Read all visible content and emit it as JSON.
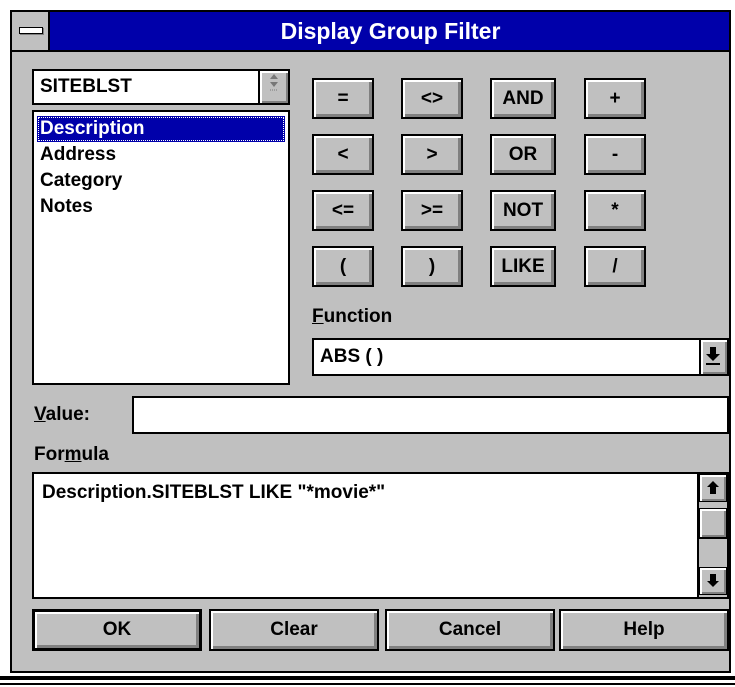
{
  "window": {
    "title": "Display Group Filter"
  },
  "table_combo": {
    "value": "SITEBLST"
  },
  "fields": {
    "items": [
      "Description",
      "Address",
      "Category",
      "Notes"
    ],
    "selected_index": 0
  },
  "operators": {
    "row1": [
      "=",
      "<>",
      "AND",
      "+"
    ],
    "row2": [
      "<",
      ">",
      "OR",
      "-"
    ],
    "row3": [
      "<=",
      ">=",
      "NOT",
      "*"
    ],
    "row4": [
      "(",
      ")",
      "LIKE",
      "/"
    ]
  },
  "function": {
    "label_mnemonic": "F",
    "label_rest": "unction",
    "value": "ABS ( )"
  },
  "value_field": {
    "label_mnemonic": "V",
    "label_rest": "alue:",
    "value": ""
  },
  "formula": {
    "label_pre": "For",
    "label_mnemonic": "m",
    "label_post": "ula",
    "text": "Description.SITEBLST LIKE  \"*movie*\""
  },
  "buttons": {
    "ok": "OK",
    "clear": "Clear",
    "cancel": "Cancel",
    "help": "Help"
  },
  "colors": {
    "titlebar": "#0000aa",
    "dialog": "#c0c0c0",
    "selection": "#0000aa"
  },
  "icons": {
    "system_menu": "system-menu-icon",
    "dropdown": "dropdown-arrow-icon",
    "scroll_up": "scroll-up-arrow-icon",
    "scroll_down": "scroll-down-arrow-icon"
  }
}
